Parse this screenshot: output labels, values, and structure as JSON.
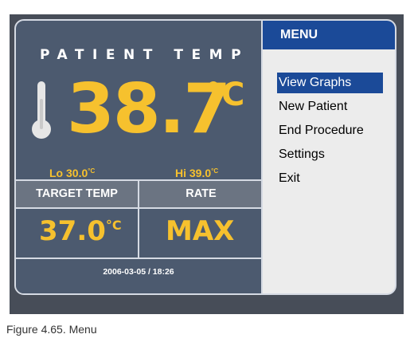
{
  "patient_panel": {
    "label": "PATIENT TEMP",
    "current_temp": "38.7",
    "unit": "°C",
    "lo_label": "Lo",
    "lo_value": "30.0",
    "hi_label": "Hi",
    "hi_value": "39.0",
    "target_label": "TARGET TEMP",
    "target_value": "37.0",
    "rate_label": "RATE",
    "rate_value": "MAX",
    "datetime": "2006-03-05 / 18:26"
  },
  "menu": {
    "title": "MENU",
    "items": [
      "View Graphs",
      "New Patient",
      "End Procedure",
      "Settings",
      "Exit"
    ],
    "selected_index": 0
  },
  "caption": "Figure 4.65. Menu",
  "colors": {
    "panel": "#4c5a6f",
    "accent_yellow": "#f6c12e",
    "menu_blue": "#1b4a98",
    "menu_bg": "#ececec"
  },
  "icons": [
    "thermometer-icon"
  ]
}
